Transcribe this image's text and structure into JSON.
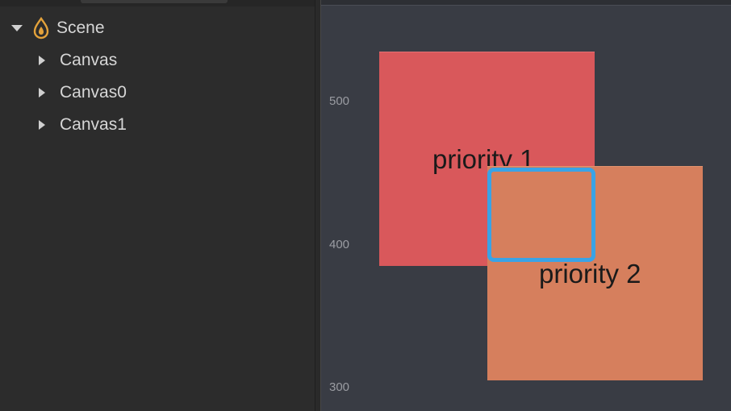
{
  "hierarchy": {
    "root": {
      "label": "Scene",
      "icon": "scene-flame-icon",
      "expanded": true
    },
    "children": [
      {
        "label": "Canvas",
        "expanded": false
      },
      {
        "label": "Canvas0",
        "expanded": false
      },
      {
        "label": "Canvas1",
        "expanded": false
      }
    ]
  },
  "viewport": {
    "ruler": {
      "labels": [
        "500",
        "400",
        "300"
      ]
    },
    "nodes": [
      {
        "label": "priority 1",
        "color": "#d9585b"
      },
      {
        "label": "priority 2",
        "color": "#d67f5d"
      }
    ],
    "selection_color": "#3aa3e6",
    "background": "#393c44"
  }
}
